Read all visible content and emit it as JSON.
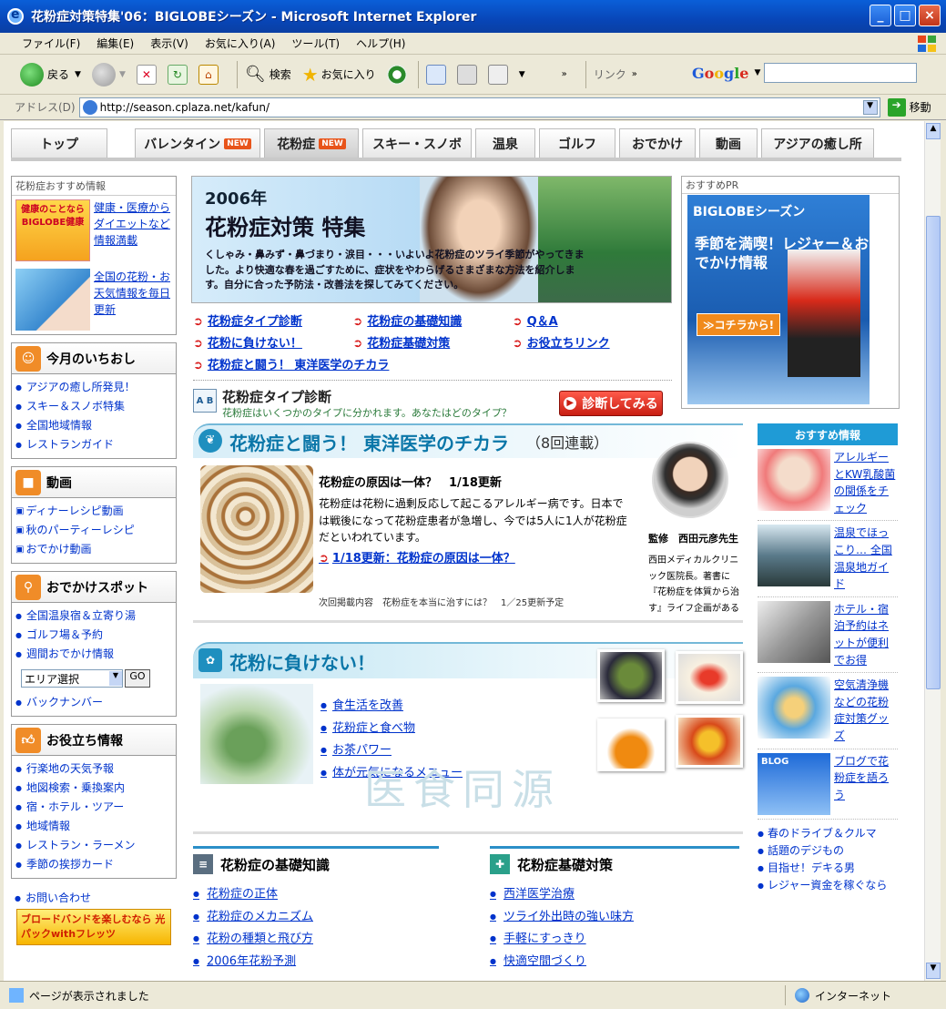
{
  "window": {
    "title": "花粉症対策特集'06：BIGLOBEシーズン - Microsoft Internet Explorer",
    "controls": [
      "_",
      "□",
      "×"
    ]
  },
  "menubar": [
    "ファイル(F)",
    "編集(E)",
    "表示(V)",
    "お気に入り(A)",
    "ツール(T)",
    "ヘルプ(H)"
  ],
  "toolbar": {
    "back": "戻る",
    "search": "検索",
    "favorites": "お気に入り",
    "links": "リンク",
    "google": "Google"
  },
  "address": {
    "label": "アドレス(D)",
    "url": "http://season.cplaza.net/kafun/",
    "go": "移動"
  },
  "tabs": [
    {
      "label": "トップ",
      "new": ""
    },
    {
      "label": "バレンタイン",
      "new": "NEW"
    },
    {
      "label": "花粉症",
      "new": "NEW"
    },
    {
      "label": "スキー・スノボ",
      "new": ""
    },
    {
      "label": "温泉",
      "new": ""
    },
    {
      "label": "ゴルフ",
      "new": ""
    },
    {
      "label": "おでかけ",
      "new": ""
    },
    {
      "label": "動画",
      "new": ""
    },
    {
      "label": "アジアの癒し所",
      "new": ""
    }
  ],
  "left": {
    "kafun_reco": {
      "head": "花粉症おすすめ情報",
      "promo1_img": "健康のことならBIGLOBE健康",
      "promo1": "健康・医療からダイエットなど情報満載",
      "promo2": "全国の花粉・お天気情報を毎日更新"
    },
    "ichioshi": {
      "head": "今月のいちおし",
      "items": [
        "アジアの癒し所発見！",
        "スキー＆スノボ特集",
        "全国地域情報",
        "レストランガイド"
      ]
    },
    "douga": {
      "head": "動画",
      "items": [
        "ディナーレシピ動画",
        "秋のパーティーレシピ",
        "おでかけ動画"
      ]
    },
    "spot": {
      "head": "おでかけスポット",
      "items": [
        "全国温泉宿＆立寄り湯",
        "ゴルフ場＆予約",
        "週間おでかけ情報"
      ],
      "select": "エリア選択",
      "go": "GO",
      "backnumber": "バックナンバー"
    },
    "yakudachi": {
      "head": "お役立ち情報",
      "items": [
        "行楽地の天気予報",
        "地図検索・乗換案内",
        "宿・ホテル・ツアー",
        "地域情報",
        "レストラン・ラーメン",
        "季節の挨拶カード"
      ]
    },
    "contact": "お問い合わせ",
    "flets": "ブロードバンドを楽しむなら 光パックwithフレッツ"
  },
  "hero": {
    "year": "2006年",
    "title": "花粉症対策 特集",
    "body": "くしゃみ・鼻みず・鼻づまり・涙目・・・いよいよ花粉症のツライ季節がやってきました。より快適な春を過ごすために、症状をやわらげるさまざまな方法を紹介します。自分に合った予防法・改善法を探してみてください。"
  },
  "quicklinks": [
    [
      "花粉症タイプ診断",
      "花粉症の基礎知識",
      "Q＆A"
    ],
    [
      "花粉に負けない！",
      "花粉症基礎対策",
      "お役立ちリンク"
    ],
    [
      "花粉症と闘う！ 東洋医学のチカラ"
    ]
  ],
  "type_diag": {
    "icon": "A B",
    "title": "花粉症タイプ診断",
    "sub": "花粉症はいくつかのタイプに分かれます。あなたはどのタイプ？",
    "button": "診断してみる"
  },
  "kampo": {
    "title": "花粉症と闘う！ 東洋医学のチカラ",
    "series": "（8回連載）",
    "article_title": "花粉症の原因は一体？　1/18更新",
    "article_text": "花粉症は花粉に過剰反応して起こるアレルギー病です。日本では戦後になって花粉症患者が急増し、今では5人に1人が花粉症だといわれています。",
    "article_link": "1/18更新：花粉症の原因は一体？",
    "next": "次回掲載内容　花粉症を本当に治すには？　1／25更新予定",
    "supervisor": "監修　西田元彦先生",
    "bio": "西田メディカルクリニック医院長。著書に『花粉症を体質から治す』ライフ企画がある"
  },
  "makenai": {
    "title": "花粉に負けない！",
    "links": [
      "食生活を改善",
      "花粉症と食べ物",
      "お茶パワー",
      "体が元気になるメニュー"
    ],
    "watermark": "医食同源"
  },
  "basics": {
    "title": "花粉症の基礎知識",
    "links": [
      "花粉症の正体",
      "花粉症のメカニズム",
      "花粉の種類と飛び方",
      "2006年花粉予測"
    ]
  },
  "taisaku": {
    "title": "花粉症基礎対策",
    "links": [
      "西洋医学治療",
      "ツライ外出時の強い味方",
      "手軽にすっきり",
      "快適空間づくり"
    ]
  },
  "pr": {
    "label": "おすすめPR",
    "logo": "BIGLOBEシーズン",
    "catch": "季節を満喫！レジャー＆おでかけ情報",
    "cta": "≫コチラから!"
  },
  "reco": {
    "head": "おすすめ情報",
    "items": [
      "アレルギーとKW乳酸菌の関係をチェック",
      "温泉でほっこり… 全国温泉地ガイド",
      "ホテル・宿泊予約はネットが便利でお得",
      "空気清浄機などの花粉症対策グッズ",
      "ブログで花粉症を語ろう"
    ],
    "links": [
      "春のドライブ＆クルマ",
      "話題のデジもの",
      "目指せ！デキる男",
      "レジャー資金を稼ぐなら"
    ]
  },
  "status": {
    "text": "ページが表示されました",
    "zone": "インターネット"
  }
}
